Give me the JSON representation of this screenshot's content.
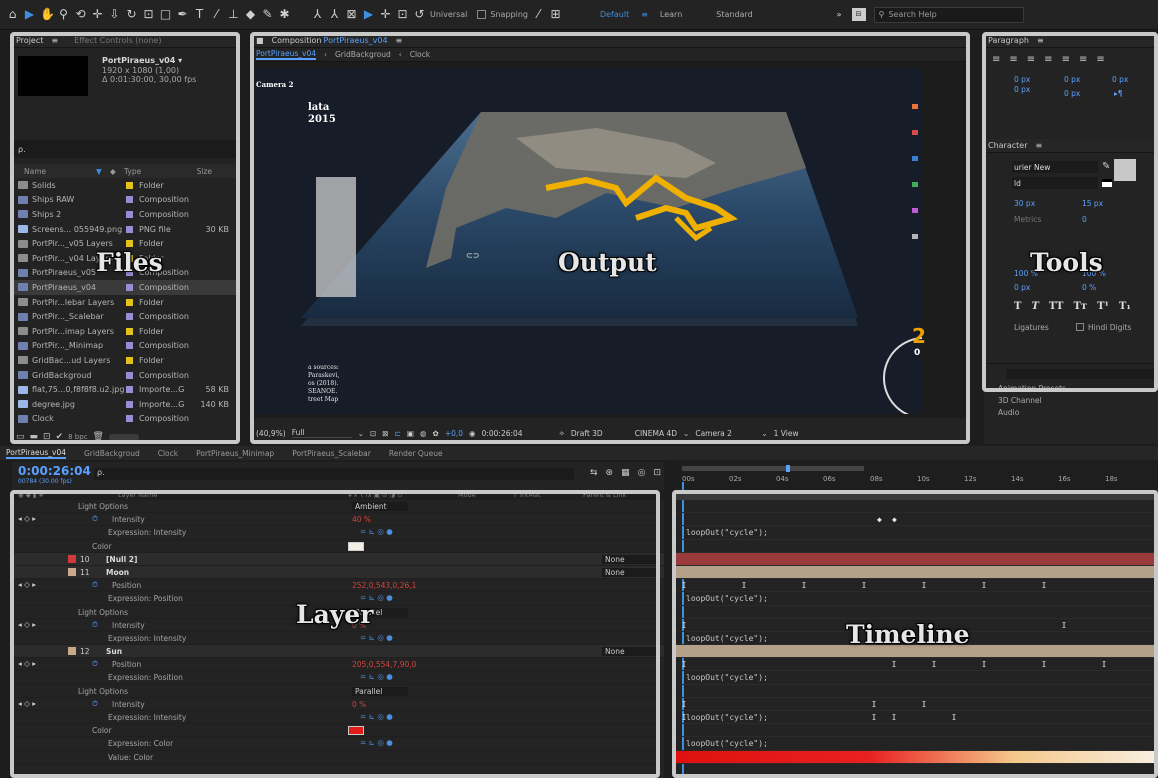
{
  "toolbar": {
    "tools": [
      "home-icon",
      "selection-icon",
      "hand-icon",
      "zoom-icon",
      "orbit-icon",
      "pan-icon",
      "dolly-icon",
      "rotate-icon",
      "region-icon",
      "rect-icon",
      "pen-icon",
      "text-icon",
      "brush-icon",
      "stamp-icon",
      "eraser-icon",
      "roto-icon",
      "puppet-icon",
      "axis-local-icon",
      "axis-world-icon",
      "axis-view-icon",
      "move-3d-icon",
      "rotate-3d-icon"
    ],
    "universal_label": "Universal",
    "snapping_label": "Snapping",
    "workspaces": [
      "Default",
      "Learn",
      "Standard"
    ],
    "search_placeholder": "Search Help"
  },
  "project": {
    "tab_project": "Project",
    "tab_effect": "Effect Controls (none)",
    "preview_name": "PortPiraeus_v04 ▾",
    "preview_res": "1920 x 1080 (1,00)",
    "preview_dur": "Δ 0:01:30:00, 30,00 fps",
    "search_placeholder": "ρ.",
    "columns": {
      "name": "Name",
      "type": "Type",
      "size": "Size"
    },
    "items": [
      {
        "name": "Solids",
        "color": "#e3c21d",
        "type": "Folder",
        "size": "",
        "kind": "folder"
      },
      {
        "name": "Ships RAW",
        "color": "#9a8bd6",
        "type": "Composition",
        "size": "",
        "kind": "comp"
      },
      {
        "name": "Ships 2",
        "color": "#9a8bd6",
        "type": "Composition",
        "size": "",
        "kind": "comp"
      },
      {
        "name": "Screens... 055949.png",
        "color": "#9a8bd6",
        "type": "PNG file",
        "size": "30 KB",
        "kind": "file"
      },
      {
        "name": "PortPir..._v05 Layers",
        "color": "#e3c21d",
        "type": "Folder",
        "size": "",
        "kind": "folder"
      },
      {
        "name": "PortPir..._v04 Layers",
        "color": "#e3c21d",
        "type": "Folder",
        "size": "",
        "kind": "folder"
      },
      {
        "name": "PortPiraeus_v05",
        "color": "#9a8bd6",
        "type": "Composition",
        "size": "",
        "kind": "comp"
      },
      {
        "name": "PortPiraeus_v04",
        "color": "#9a8bd6",
        "type": "Composition",
        "size": "",
        "kind": "comp",
        "selected": true
      },
      {
        "name": "PortPir...lebar Layers",
        "color": "#e3c21d",
        "type": "Folder",
        "size": "",
        "kind": "folder"
      },
      {
        "name": "PortPir..._Scalebar",
        "color": "#9a8bd6",
        "type": "Composition",
        "size": "",
        "kind": "comp"
      },
      {
        "name": "PortPir...imap Layers",
        "color": "#e3c21d",
        "type": "Folder",
        "size": "",
        "kind": "folder"
      },
      {
        "name": "PortPir..._Minimap",
        "color": "#9a8bd6",
        "type": "Composition",
        "size": "",
        "kind": "comp"
      },
      {
        "name": "GridBac...ud Layers",
        "color": "#e3c21d",
        "type": "Folder",
        "size": "",
        "kind": "folder"
      },
      {
        "name": "GridBackgroud",
        "color": "#9a8bd6",
        "type": "Composition",
        "size": "",
        "kind": "comp"
      },
      {
        "name": "flat,75...0,f8f8f8.u2.jpg",
        "color": "#9a8bd6",
        "type": "Importe...G",
        "size": "58 KB",
        "kind": "file"
      },
      {
        "name": "degree.jpg",
        "color": "#9a8bd6",
        "type": "Importe...G",
        "size": "140 KB",
        "kind": "file"
      },
      {
        "name": "Clock",
        "color": "#9a8bd6",
        "type": "Composition",
        "size": "",
        "kind": "comp"
      }
    ],
    "bpc_label": "8 bpc"
  },
  "composition": {
    "header_prefix": "Composition",
    "header_name": "PortPiraeus_v04",
    "breadcrumb": [
      "PortPiraeus_v04",
      "GridBackgroud",
      "Clock"
    ],
    "camera_label": "Camera 2",
    "overlay_text": [
      "lata",
      "2015"
    ],
    "source_lines": [
      "a sources:",
      "Paraskevi,",
      "os (2018).",
      "SEANOE.",
      "treet Map"
    ],
    "clock_digit": "2",
    "clock_sub": "0",
    "footer": {
      "zoom": "(40,9%)",
      "resolution": "Full",
      "exposure": "+0,0",
      "timecode": "0:00:26:04",
      "draft": "Draft 3D",
      "renderer": "CINEMA 4D",
      "camera": "Camera 2",
      "views": "1 View"
    },
    "label_colors": [
      "#e8743b",
      "#d64b4b",
      "#3b7fd4",
      "#3fae5a",
      "#c05bd6",
      "#b5b5b5"
    ]
  },
  "paragraph": {
    "title": "Paragraph",
    "values": [
      "0 px",
      "0 px",
      "0 px",
      "0 px",
      "0 px"
    ]
  },
  "character": {
    "title": "Character",
    "font": "urier New",
    "style": "ld",
    "size": "30 px",
    "leading": "15 px",
    "kerning": "Metrics",
    "tracking": "0",
    "vscale": "100 %",
    "hscale": "100 %",
    "baseline": "0 px",
    "tsume": "0 %",
    "ligatures_label": "Ligatures",
    "hindi_label": "Hindi Digits"
  },
  "effects": {
    "items": [
      "Animation Presets",
      "3D Channel",
      "Audio"
    ]
  },
  "timeline": {
    "tabs": [
      "PortPiraeus_v04",
      "GridBackgroud",
      "Clock",
      "PortPiraeus_Minimap",
      "PortPiraeus_Scalebar",
      "Render Queue"
    ],
    "timecode": "0:00:26:04",
    "frame_info": "00784 (30.00 fps)",
    "col_layer_name": "Layer Name",
    "col_mode": "Mode",
    "col_trkmat": "T  TrkMat",
    "col_parent": "Parent & Link",
    "ruler": [
      "00s",
      "02s",
      "04s",
      "06s",
      "08s",
      "10s",
      "12s",
      "14s",
      "16s",
      "18s"
    ],
    "expression_text": "loopOut(\"cycle\");",
    "layers": [
      {
        "name": "Light Options",
        "value": "Ambient",
        "kind": "group"
      },
      {
        "name": "Intensity",
        "value": "40 %",
        "kind": "prop"
      },
      {
        "name": "Expression: Intensity",
        "value": "",
        "kind": "expr"
      },
      {
        "name": "Color",
        "value": "",
        "kind": "color"
      },
      {
        "num": "10",
        "name": "[Null 2]",
        "value": "",
        "parent": "None",
        "kind": "layer",
        "label": "#d23b3b"
      },
      {
        "num": "11",
        "name": "Moon",
        "value": "",
        "parent": "None",
        "kind": "layer",
        "label": "#c8a98a"
      },
      {
        "name": "Position",
        "value": "252,0,543,0,26,1",
        "kind": "prop"
      },
      {
        "name": "Expression: Position",
        "value": "",
        "kind": "expr"
      },
      {
        "name": "Light Options",
        "value": "Parallel",
        "kind": "group"
      },
      {
        "name": "Intensity",
        "value": "0 %",
        "kind": "prop"
      },
      {
        "name": "Expression: Intensity",
        "value": "",
        "kind": "expr"
      },
      {
        "num": "12",
        "name": "Sun",
        "value": "",
        "parent": "None",
        "kind": "layer",
        "label": "#c8a98a"
      },
      {
        "name": "Position",
        "value": "205,0,554,7,90,0",
        "kind": "prop"
      },
      {
        "name": "Expression: Position",
        "value": "",
        "kind": "expr"
      },
      {
        "name": "Light Options",
        "value": "Parallel",
        "kind": "group"
      },
      {
        "name": "Intensity",
        "value": "0 %",
        "kind": "prop"
      },
      {
        "name": "Expression: Intensity",
        "value": "",
        "kind": "expr"
      },
      {
        "name": "Color",
        "value": "",
        "kind": "color2"
      },
      {
        "name": "Expression: Color",
        "value": "",
        "kind": "expr"
      },
      {
        "name": "Value: Color",
        "value": "",
        "kind": "plain"
      }
    ]
  },
  "labels": {
    "files": "Files",
    "output": "Output",
    "tools": "Tools",
    "layer": "Layer",
    "timeline": "Timeline"
  }
}
